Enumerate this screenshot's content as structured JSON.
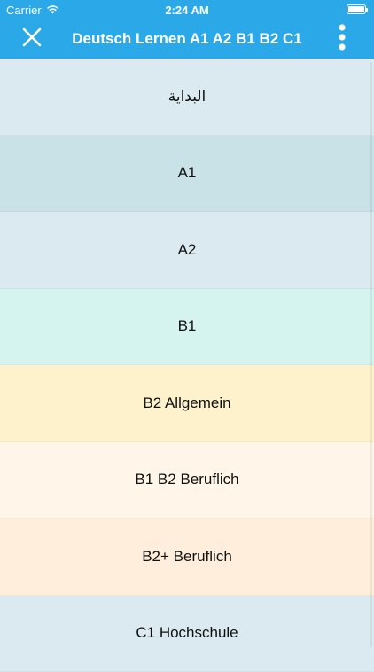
{
  "status_bar": {
    "carrier": "Carrier",
    "time": "2:24 AM",
    "wifi_icon": "wifi-icon",
    "battery_icon": "battery-icon"
  },
  "nav": {
    "title": "Deutsch Lernen A1 A2 B1 B2 C1",
    "close_icon": "close-icon",
    "more_icon": "more-vertical-icon",
    "background": "#2aa8e8"
  },
  "menu": {
    "items": [
      {
        "label": "البداية",
        "color": "#dbeaf1"
      },
      {
        "label": "A1",
        "color": "#c9e2e7"
      },
      {
        "label": "A2",
        "color": "#dbeaf1"
      },
      {
        "label": "B1",
        "color": "#d6f4ef"
      },
      {
        "label": "B2 Allgemein",
        "color": "#fef2cc"
      },
      {
        "label": "B1 B2 Beruflich",
        "color": "#fff5e9"
      },
      {
        "label": "B2+ Beruflich",
        "color": "#ffeedb"
      },
      {
        "label": "C1 Hochschule",
        "color": "#dbeaf1"
      }
    ]
  }
}
